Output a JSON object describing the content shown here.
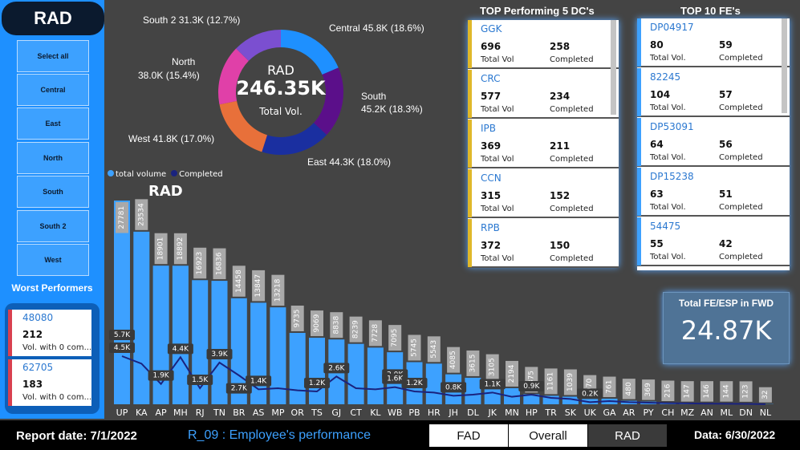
{
  "sidebar": {
    "title": "RAD",
    "slicers": [
      "Select all",
      "Central",
      "East",
      "North",
      "South",
      "South 2",
      "West"
    ],
    "worst_title": "Worst Performers",
    "worst": [
      {
        "id": "48080",
        "value": "212",
        "label": "Vol. with 0 com..."
      },
      {
        "id": "62705",
        "value": "183",
        "label": "Vol. with 0 com..."
      }
    ]
  },
  "donut": {
    "center_title": "RAD",
    "center_value": "246.35K",
    "center_sub": "Total Vol.",
    "labels": {
      "south2": "South 2 31.3K (12.7%)",
      "central": "Central 45.8K (18.6%)",
      "north_1": "North",
      "north_2": "38.0K (15.4%)",
      "south_1": "South",
      "south_2": "45.2K (18.3%)",
      "west": "West 41.8K (17.0%)",
      "east": "East 44.3K (18.0%)"
    }
  },
  "chart_data": {
    "type": "bar",
    "title": "RAD",
    "legend": [
      "total volume",
      "Completed"
    ],
    "colors": {
      "total_volume": "#3da1ff",
      "completed": "#1a237e",
      "label_bg": "#a9a9a9"
    },
    "categories": [
      "UP",
      "KA",
      "AP",
      "MH",
      "RJ",
      "TN",
      "BR",
      "AS",
      "MP",
      "OR",
      "TS",
      "GJ",
      "CT",
      "KL",
      "WB",
      "PB",
      "HR",
      "JH",
      "DL",
      "JK",
      "MN",
      "HP",
      "TR",
      "SK",
      "UK",
      "GA",
      "AR",
      "PY",
      "CH",
      "MZ",
      "AN",
      "ML",
      "DN",
      "NL"
    ],
    "series": [
      {
        "name": "total volume",
        "values": [
          27781,
          23534,
          18901,
          18892,
          16923,
          16836,
          14458,
          13847,
          13218,
          9735,
          9069,
          8838,
          8239,
          7728,
          7095,
          5745,
          5543,
          4085,
          3615,
          3105,
          2194,
          1375,
          1161,
          1039,
          970,
          761,
          480,
          369,
          216,
          147,
          146,
          144,
          123,
          32
        ]
      },
      {
        "name": "Completed",
        "values": [
          4500,
          3800,
          1900,
          4400,
          1500,
          3900,
          2700,
          1400,
          1500,
          1300,
          1200,
          2600,
          1500,
          1400,
          1600,
          1200,
          1100,
          800,
          900,
          1100,
          700,
          900,
          600,
          500,
          200,
          300,
          200,
          150,
          100,
          80,
          60,
          50,
          40,
          10
        ]
      }
    ],
    "completed_labels": [
      {
        "i": 0,
        "text": "5.7K",
        "v": 5700
      },
      {
        "i": 0,
        "text": "4.5K",
        "v": 4500
      },
      {
        "i": 2,
        "text": "1.9K",
        "v": 1900
      },
      {
        "i": 3,
        "text": "4.4K",
        "v": 4400
      },
      {
        "i": 4,
        "text": "1.5K",
        "v": 1500
      },
      {
        "i": 5,
        "text": "3.9K",
        "v": 3900
      },
      {
        "i": 6,
        "text": "2.7K",
        "v": 700
      },
      {
        "i": 7,
        "text": "1.4K",
        "v": 1400
      },
      {
        "i": 10,
        "text": "1.2K",
        "v": 1200
      },
      {
        "i": 11,
        "text": "2.6K",
        "v": 2600
      },
      {
        "i": 14,
        "text": "2.0K",
        "v": 2000
      },
      {
        "i": 14,
        "text": "1.6K",
        "v": 1600
      },
      {
        "i": 15,
        "text": "1.2K",
        "v": 1200
      },
      {
        "i": 17,
        "text": "0.8K",
        "v": 800
      },
      {
        "i": 19,
        "text": "1.1K",
        "v": 1100
      },
      {
        "i": 21,
        "text": "0.9K",
        "v": 900
      },
      {
        "i": 24,
        "text": "0.2K",
        "v": 200
      }
    ]
  },
  "top_dc": {
    "title": "TOP Performing 5 DC's",
    "cards": [
      {
        "id": "GGK",
        "v1": "696",
        "l1": "Total Vol",
        "v2": "258",
        "l2": "Completed"
      },
      {
        "id": "CRC",
        "v1": "577",
        "l1": "Total Vol",
        "v2": "234",
        "l2": "Completed"
      },
      {
        "id": "IPB",
        "v1": "369",
        "l1": "Total Vol",
        "v2": "211",
        "l2": "Completed"
      },
      {
        "id": "CCN",
        "v1": "315",
        "l1": "Total Vol",
        "v2": "152",
        "l2": "Completed"
      },
      {
        "id": "RPB",
        "v1": "372",
        "l1": "Total Vol",
        "v2": "150",
        "l2": "Completed"
      }
    ],
    "accent": "#e0b82a"
  },
  "top_fe": {
    "title": "TOP 10 FE's",
    "cards": [
      {
        "id": "DP04917",
        "v1": "80",
        "l1": "Total Vol.",
        "v2": "59",
        "l2": "Completed"
      },
      {
        "id": "82245",
        "v1": "104",
        "l1": "Total Vol.",
        "v2": "57",
        "l2": "Completed"
      },
      {
        "id": "DP53091",
        "v1": "64",
        "l1": "Total Vol.",
        "v2": "56",
        "l2": "Completed"
      },
      {
        "id": "DP15238",
        "v1": "63",
        "l1": "Total Vol.",
        "v2": "51",
        "l2": "Completed"
      },
      {
        "id": "54475",
        "v1": "55",
        "l1": "Total Vol.",
        "v2": "42",
        "l2": "Completed"
      }
    ],
    "accent": "#3da1ff"
  },
  "kpi": {
    "label": "Total FE/ESP in FWD",
    "value": "24.87K"
  },
  "footer": {
    "report_date": "Report date: 7/1/2022",
    "report_name": "R_09 : Employee's performance",
    "tabs": [
      "FAD",
      "Overall",
      "RAD"
    ],
    "data_date": "Data: 6/30/2022"
  }
}
